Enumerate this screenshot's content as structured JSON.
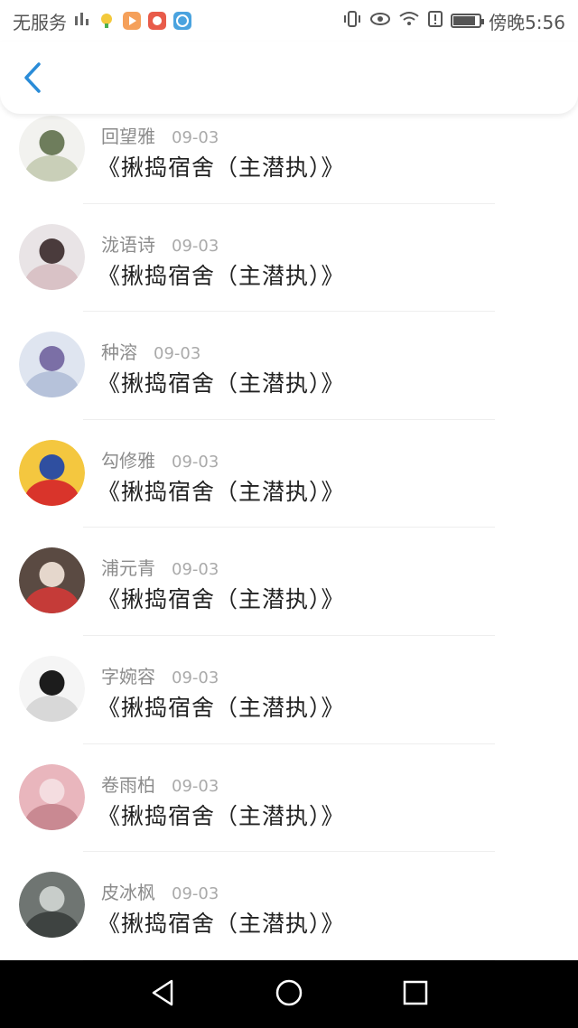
{
  "status_bar": {
    "carrier": "无服务",
    "clock": "傍晚5:56",
    "battery_level": 0.85,
    "icons": [
      "signal-icon",
      "app-icon-yellow",
      "app-icon-orange",
      "app-icon-red",
      "app-icon-blue",
      "vibrate-icon",
      "eye-icon",
      "wifi-icon",
      "alert-icon",
      "battery-icon"
    ]
  },
  "header": {
    "back_icon": "chevron-left-icon",
    "accent_color": "#2a8cd8"
  },
  "list": {
    "items": [
      {
        "author": "回望雅",
        "date": "09-03",
        "title": "《揪捣宿舍（主潜执）》",
        "avatar_colors": [
          "#f2f2ef",
          "#c9cfb8",
          "#6e7d5c"
        ]
      },
      {
        "author": "泷语诗",
        "date": "09-03",
        "title": "《揪捣宿舍（主潜执）》",
        "avatar_colors": [
          "#e9e4e6",
          "#d9c2c6",
          "#4a3b3c"
        ]
      },
      {
        "author": "种溶",
        "date": "09-03",
        "title": "《揪捣宿舍（主潜执）》",
        "avatar_colors": [
          "#dfe5f0",
          "#b6c2da",
          "#7b6fa6"
        ]
      },
      {
        "author": "勾修雅",
        "date": "09-03",
        "title": "《揪捣宿舍（主潜执）》",
        "avatar_colors": [
          "#f4c73f",
          "#d9342b",
          "#2f4fa0"
        ]
      },
      {
        "author": "浦元青",
        "date": "09-03",
        "title": "《揪捣宿舍（主潜执）》",
        "avatar_colors": [
          "#5a4a42",
          "#c53b38",
          "#e5d7cc"
        ]
      },
      {
        "author": "字婉容",
        "date": "09-03",
        "title": "《揪捣宿舍（主潜执）》",
        "avatar_colors": [
          "#f5f5f5",
          "#d8d8d8",
          "#1c1c1c"
        ]
      },
      {
        "author": "卷雨柏",
        "date": "09-03",
        "title": "《揪捣宿舍（主潜执）》",
        "avatar_colors": [
          "#e9b6bd",
          "#c98992",
          "#f4dde0"
        ]
      },
      {
        "author": "皮冰枫",
        "date": "09-03",
        "title": "《揪捣宿舍（主潜执）》",
        "avatar_colors": [
          "#6f7572",
          "#3e4341",
          "#c8cdca"
        ]
      }
    ]
  },
  "nav_bar": {
    "buttons": [
      "back-triangle-icon",
      "home-circle-icon",
      "recents-square-icon"
    ]
  }
}
